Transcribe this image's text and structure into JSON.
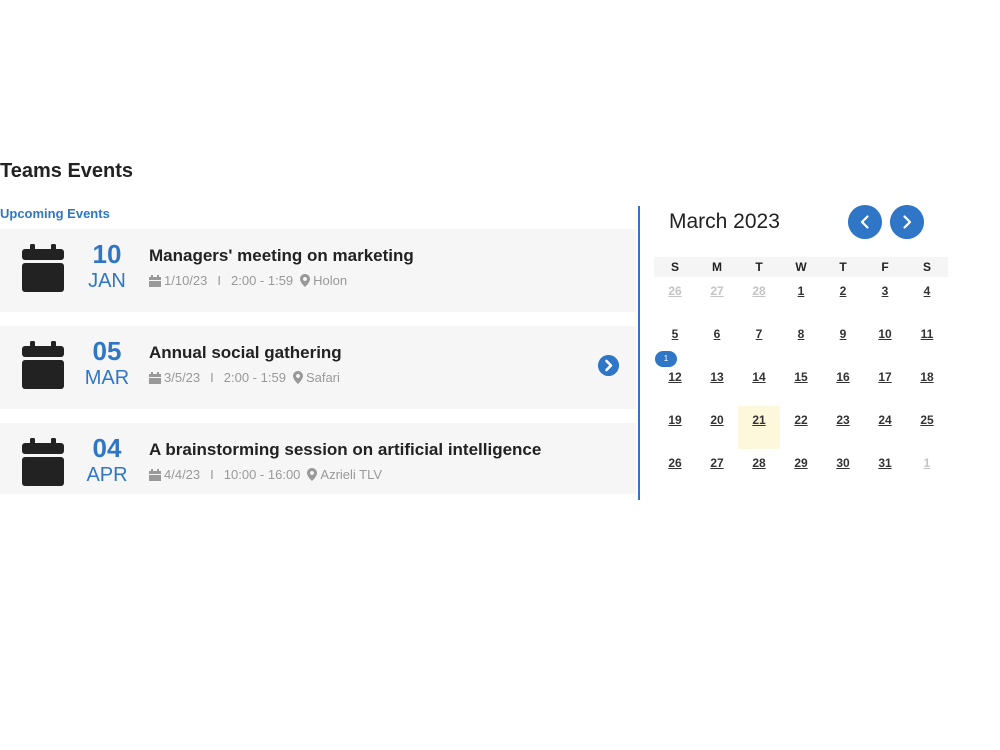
{
  "page": {
    "title": "Teams Events",
    "section_label": "Upcoming Events"
  },
  "events": [
    {
      "day": "10",
      "month": "JAN",
      "title": "Managers' meeting on marketing",
      "date": "1/10/23",
      "separator": "I",
      "time": "2:00 - 1:59",
      "location": "Holon"
    },
    {
      "day": "05",
      "month": "MAR",
      "title": "Annual social gathering",
      "date": "3/5/23",
      "separator": "I",
      "time": "2:00 - 1:59",
      "location": "Safari"
    },
    {
      "day": "04",
      "month": "APR",
      "title": "A brainstorming session on artificial intelligence",
      "date": "4/4/23",
      "separator": "I",
      "time": "10:00 - 16:00",
      "location": "Azrieli TLV"
    }
  ],
  "calendar": {
    "month_title": "March 2023",
    "weekdays": [
      "S",
      "M",
      "T",
      "W",
      "T",
      "F",
      "S"
    ],
    "weeks": [
      [
        "26",
        "27",
        "28",
        "1",
        "2",
        "3",
        "4"
      ],
      [
        "5",
        "6",
        "7",
        "8",
        "9",
        "10",
        "11"
      ],
      [
        "12",
        "13",
        "14",
        "15",
        "16",
        "17",
        "18"
      ],
      [
        "19",
        "20",
        "21",
        "22",
        "23",
        "24",
        "25"
      ],
      [
        "26",
        "27",
        "28",
        "29",
        "30",
        "31",
        "1"
      ]
    ],
    "event_badge": "1"
  },
  "colors": {
    "accent": "#2f77c6",
    "card_bg": "#f6f6f6",
    "today_bg": "#fdf8dc",
    "muted_text": "#c4c4c4"
  },
  "icons": {
    "event_card": "calendar-icon",
    "meta_date": "calendar-small-icon",
    "meta_location": "map-pin-icon",
    "expand": "chevron-right-icon",
    "prev_month": "chevron-left-icon",
    "next_month": "chevron-right-icon"
  }
}
